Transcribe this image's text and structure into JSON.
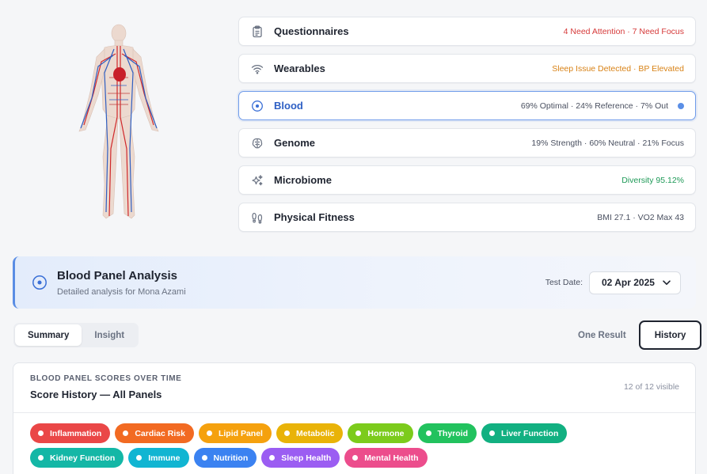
{
  "sources": [
    {
      "title": "Questionnaires",
      "icon": "clipboard-icon",
      "status": "4 Need Attention · 7 Need Focus",
      "tone": "red"
    },
    {
      "title": "Wearables",
      "icon": "wifi-signal-icon",
      "status": "Sleep Issue Detected · BP Elevated",
      "tone": "orange"
    },
    {
      "title": "Blood",
      "icon": "target-circle-icon",
      "status": "69% Optimal · 24% Reference · 7% Out",
      "tone": "neutral",
      "active": true
    },
    {
      "title": "Genome",
      "icon": "brain-icon",
      "status": "19% Strength · 60% Neutral · 21% Focus",
      "tone": "neutral"
    },
    {
      "title": "Microbiome",
      "icon": "sparkles-icon",
      "status": "Diversity 95.12%",
      "tone": "green"
    },
    {
      "title": "Physical Fitness",
      "icon": "footprints-icon",
      "status": "BMI 27.1 · VO2 Max 43",
      "tone": "neutral"
    }
  ],
  "analysis": {
    "title": "Blood Panel Analysis",
    "subtitle": "Detailed analysis for Mona Azami",
    "test_date_label": "Test Date:",
    "test_date": "02 Apr 2025"
  },
  "tabs": {
    "summary": "Summary",
    "insight": "Insight"
  },
  "view_toggle": {
    "one_result": "One Result",
    "history": "History"
  },
  "history": {
    "kicker": "BLOOD PANEL SCORES OVER TIME",
    "title": "Score History — All Panels",
    "count": "12 of 12 visible"
  },
  "panels": [
    {
      "label": "Inflammation",
      "color": "#ea4747"
    },
    {
      "label": "Cardiac Risk",
      "color": "#f26a22"
    },
    {
      "label": "Lipid Panel",
      "color": "#f5a10e"
    },
    {
      "label": "Metabolic",
      "color": "#e9b308"
    },
    {
      "label": "Hormone",
      "color": "#7ccb1c"
    },
    {
      "label": "Thyroid",
      "color": "#22c25e"
    },
    {
      "label": "Liver Function",
      "color": "#12b081"
    },
    {
      "label": "Kidney Function",
      "color": "#14b7a6"
    },
    {
      "label": "Immune",
      "color": "#11b5d2"
    },
    {
      "label": "Nutrition",
      "color": "#3b82f1"
    },
    {
      "label": "Sleep Health",
      "color": "#9b5df2"
    },
    {
      "label": "Mental Health",
      "color": "#ec4d8c"
    }
  ]
}
